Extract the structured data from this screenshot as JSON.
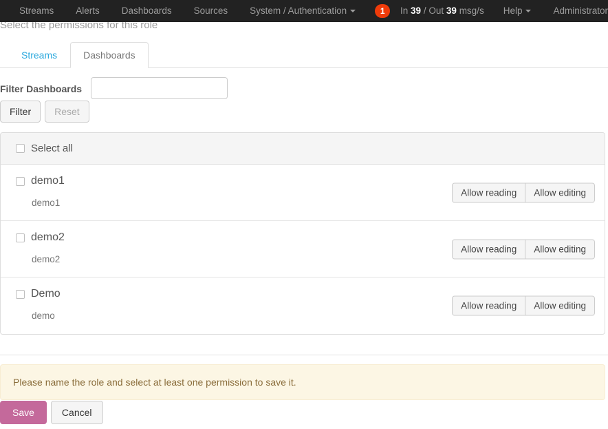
{
  "navbar": {
    "background": "#222222",
    "items": [
      {
        "label": "Streams",
        "has_caret": false
      },
      {
        "label": "Alerts",
        "has_caret": false
      },
      {
        "label": "Dashboards",
        "has_caret": false
      },
      {
        "label": "Sources",
        "has_caret": false
      },
      {
        "label": "System / Authentication",
        "has_caret": true
      }
    ],
    "notification_badge": {
      "count": "1",
      "color": "#ef3b0a"
    },
    "throughput": {
      "in_label": "In",
      "in_value": "39",
      "separator": "/",
      "out_label": "Out",
      "out_value": "39",
      "unit": "msg/s"
    },
    "help": {
      "label": "Help",
      "has_caret": true
    },
    "user": {
      "label": "Administrator"
    }
  },
  "page": {
    "subtitle": "Select the permissions for this role"
  },
  "tabs": [
    {
      "label": "Streams",
      "active": false
    },
    {
      "label": "Dashboards",
      "active": true
    }
  ],
  "filter": {
    "label": "Filter Dashboards",
    "input_value": "",
    "input_placeholder": "",
    "filter_button": "Filter",
    "reset_button": "Reset"
  },
  "list": {
    "select_all_label": "Select all",
    "select_all_checked": false,
    "read_button_label": "Allow reading",
    "edit_button_label": "Allow editing",
    "items": [
      {
        "title": "demo1",
        "description": "demo1",
        "checked": false
      },
      {
        "title": "demo2",
        "description": "demo2",
        "checked": false
      },
      {
        "title": "Demo",
        "description": "demo",
        "checked": false
      }
    ]
  },
  "alert": {
    "message": "Please name the role and select at least one permission to save it.",
    "background": "#fcf6e4",
    "text_color": "#8a6d3b"
  },
  "footer": {
    "save_label": "Save",
    "save_color": "#c4699b",
    "cancel_label": "Cancel"
  }
}
